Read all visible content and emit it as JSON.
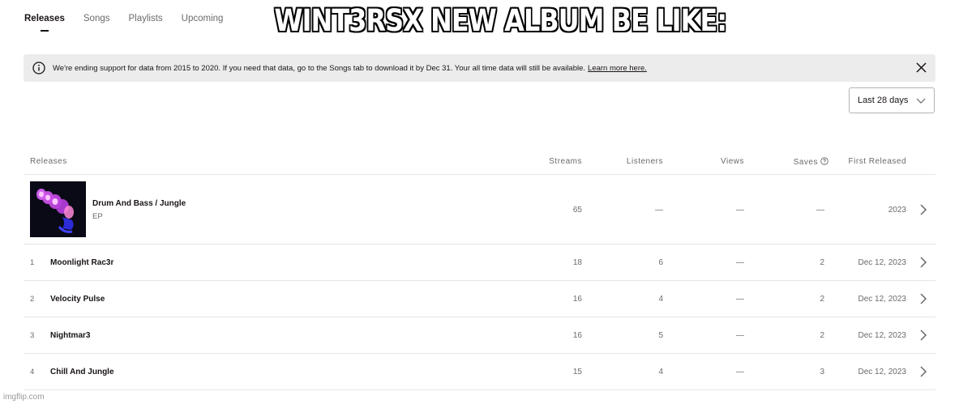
{
  "tabs": [
    {
      "label": "Releases",
      "active": true
    },
    {
      "label": "Songs",
      "active": false
    },
    {
      "label": "Playlists",
      "active": false
    },
    {
      "label": "Upcoming",
      "active": false
    }
  ],
  "meme_caption": "WINT3RSX NEW ALBUM BE LIKE:",
  "banner": {
    "icon": "info-icon",
    "text": "We're ending support for data from 2015 to 2020. If you need that data, go to the Songs tab to download it by Dec 31. Your all time data will still be available.",
    "link": "Learn more here.",
    "close_icon": "close-icon"
  },
  "date_filter": {
    "value": "Last 28 days"
  },
  "table": {
    "headers": {
      "releases": "Releases",
      "streams": "Streams",
      "listeners": "Listeners",
      "views": "Views",
      "saves": "Saves",
      "first_released": "First Released"
    },
    "release": {
      "title": "Drum And Bass / Jungle",
      "type": "EP",
      "streams": "65",
      "listeners": "—",
      "views": "—",
      "saves": "—",
      "first_released": "2023"
    },
    "tracks": [
      {
        "num": "1",
        "name": "Moonlight Rac3r",
        "streams": "18",
        "listeners": "6",
        "views": "—",
        "saves": "2",
        "first_released": "Dec 12, 2023"
      },
      {
        "num": "2",
        "name": "Velocity Pulse",
        "streams": "16",
        "listeners": "4",
        "views": "—",
        "saves": "2",
        "first_released": "Dec 12, 2023"
      },
      {
        "num": "3",
        "name": "Nightmar3",
        "streams": "16",
        "listeners": "5",
        "views": "—",
        "saves": "2",
        "first_released": "Dec 12, 2023"
      },
      {
        "num": "4",
        "name": "Chill And Jungle",
        "streams": "15",
        "listeners": "4",
        "views": "—",
        "saves": "3",
        "first_released": "Dec 12, 2023"
      }
    ]
  },
  "watermark": "imgflip.com",
  "colors": {
    "text": "#191414",
    "muted": "#6a6a6a",
    "banner_bg": "#ececec",
    "divider": "#e5e5e5"
  }
}
